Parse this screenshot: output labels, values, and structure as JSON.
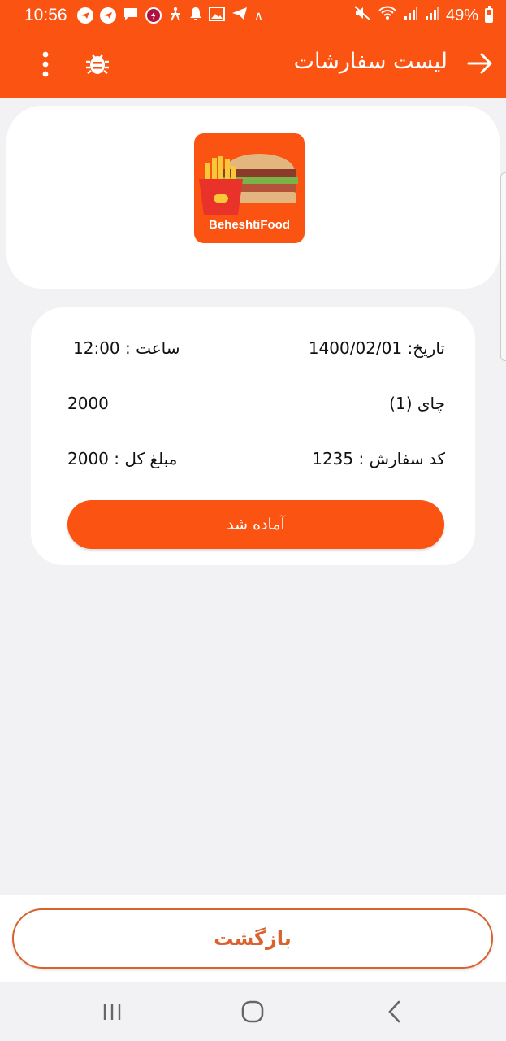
{
  "status_bar": {
    "time": "10:56",
    "battery": "49%",
    "left_icons": [
      "telegram-icon",
      "telegram-icon",
      "chat-icon",
      "power-app-icon",
      "accessibility-icon",
      "bell-icon",
      "image-icon",
      "telegram-icon",
      "caret-up-icon"
    ],
    "right_icons": [
      "mute-icon",
      "wifi-icon",
      "signal-icon",
      "signal-icon",
      "battery-icon"
    ]
  },
  "app_bar": {
    "title": "لیست سفارشات",
    "color": "#fb5312"
  },
  "logo": {
    "brand_text": "BeheshtiFood"
  },
  "order": {
    "date_label": "تاریخ: 1400/02/01",
    "time_label": "ساعت : 12:00",
    "item_label": "چای (1)",
    "item_price": "2000",
    "order_code_label": "کد سفارش : 1235",
    "total_label": "مبلغ کل : 2000",
    "ready_button": "آماده شد"
  },
  "footer": {
    "back_button": "بازگشت"
  },
  "colors": {
    "accent": "#fb5312",
    "back_button_text": "#d9622e",
    "background": "#f2f2f4"
  }
}
